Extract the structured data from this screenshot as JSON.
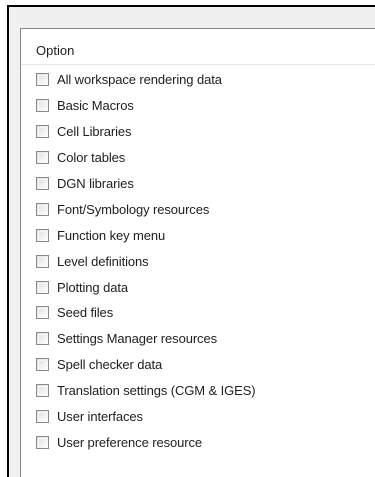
{
  "list": {
    "header": "Option",
    "items": [
      {
        "label": "All workspace rendering data",
        "checked": false
      },
      {
        "label": "Basic Macros",
        "checked": false
      },
      {
        "label": "Cell Libraries",
        "checked": false
      },
      {
        "label": "Color tables",
        "checked": false
      },
      {
        "label": "DGN libraries",
        "checked": false
      },
      {
        "label": "Font/Symbology resources",
        "checked": false
      },
      {
        "label": "Function key menu",
        "checked": false
      },
      {
        "label": "Level definitions",
        "checked": false
      },
      {
        "label": "Plotting data",
        "checked": false
      },
      {
        "label": "Seed files",
        "checked": false
      },
      {
        "label": "Settings Manager resources",
        "checked": false
      },
      {
        "label": "Spell checker data",
        "checked": false
      },
      {
        "label": "Translation settings (CGM & IGES)",
        "checked": false
      },
      {
        "label": "User interfaces",
        "checked": false
      },
      {
        "label": "User preference resource",
        "checked": false
      }
    ]
  }
}
